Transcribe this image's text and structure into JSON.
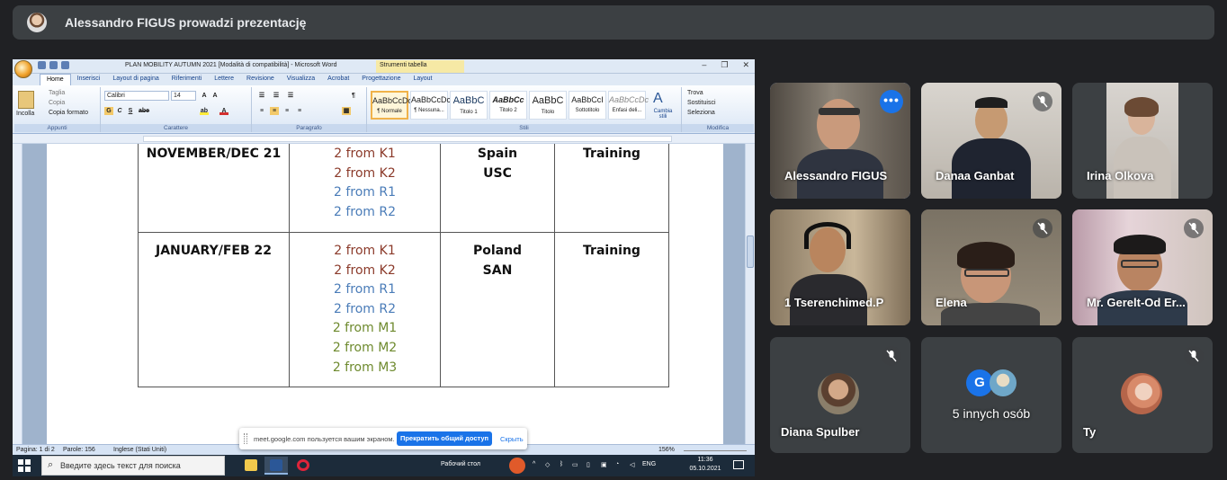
{
  "meet": {
    "header_title": "Alessandro FIGUS prowadzi prezentację"
  },
  "word": {
    "window_title": "PLAN MOBILITY AUTUMN 2021 [Modalità di compatibilità] - Microsoft Word",
    "tools_title": "Strumenti tabella",
    "tabs": [
      "Home",
      "Inserisci",
      "Layout di pagina",
      "Riferimenti",
      "Lettere",
      "Revisione",
      "Visualizza",
      "Acrobat",
      "Progettazione",
      "Layout"
    ],
    "clipboard": {
      "paste": "Incolla",
      "cut": "Taglia",
      "copy": "Copia",
      "format_painter": "Copia formato",
      "group": "Appunti"
    },
    "font": {
      "name": "Calibri",
      "size": "14",
      "group": "Carattere"
    },
    "paragraph_group": "Paragrafo",
    "styles": [
      {
        "preview": "AaBbCcDc",
        "name": "¶ Normale"
      },
      {
        "preview": "AaBbCcDc",
        "name": "¶ Nessuna..."
      },
      {
        "preview": "AaBbC",
        "name": "Titolo 1"
      },
      {
        "preview": "AaBbCc",
        "name": "Titolo 2"
      },
      {
        "preview": "AaBbC",
        "name": "Titolo"
      },
      {
        "preview": "AaBbCcI",
        "name": "Sottotitolo"
      },
      {
        "preview": "AaBbCcDc",
        "name": "Enfasi deli..."
      }
    ],
    "styles_group": "Stili",
    "change_styles": "Cambia stili",
    "editing": {
      "find": "Trova",
      "replace": "Sostituisci",
      "select": "Seleziona",
      "group": "Modifica"
    },
    "status": {
      "page": "Pagina: 1 di 2",
      "words": "Parole: 156",
      "language": "Inglese (Stati Uniti)",
      "zoom": "156%"
    }
  },
  "table": {
    "rows": [
      {
        "period": "NOVEMBER/DEC 21",
        "participants": [
          {
            "text": "2 from K1",
            "group": "K"
          },
          {
            "text": "2 from K2",
            "group": "K"
          },
          {
            "text": "2 from R1",
            "group": "R"
          },
          {
            "text": "2 from R2",
            "group": "R"
          }
        ],
        "destination": [
          "Spain",
          "USC"
        ],
        "activity": "Training"
      },
      {
        "period": "JANUARY/FEB 22",
        "participants": [
          {
            "text": "2 from K1",
            "group": "K"
          },
          {
            "text": "2 from K2",
            "group": "K"
          },
          {
            "text": "2 from R1",
            "group": "R"
          },
          {
            "text": "2 from R2",
            "group": "R"
          },
          {
            "text": "2 from M1",
            "group": "M"
          },
          {
            "text": "2 from M2",
            "group": "M"
          },
          {
            "text": "2 from M3",
            "group": "M"
          }
        ],
        "destination": [
          "Poland",
          "SAN"
        ],
        "activity": "Training"
      }
    ]
  },
  "share_notice": {
    "message": "meet.google.com пользуется вашим экраном.",
    "stop_button": "Прекратить общий доступ",
    "hide_link": "Скрыть"
  },
  "taskbar": {
    "search_placeholder": "Введите здесь текст для поиска",
    "desktop_label": "Рабочий стол",
    "lang": "ENG",
    "time": "11:36",
    "date": "05.10.2021"
  },
  "participants": [
    {
      "name": "Alessandro FIGUS",
      "muted": false,
      "video": true
    },
    {
      "name": "Danaa Ganbat",
      "muted": true,
      "video": true
    },
    {
      "name": "Irina Olkova",
      "muted": false,
      "video": true
    },
    {
      "name": "1 Tserenchimed.P",
      "muted": false,
      "video": true
    },
    {
      "name": "Elena",
      "muted": true,
      "video": true
    },
    {
      "name": "Mr. Gerelt-Od Er...",
      "muted": true,
      "video": true
    },
    {
      "name": "Diana Spulber",
      "muted": true,
      "video": false
    },
    {
      "name": "5 innych osób",
      "muted": false,
      "video": false,
      "avatar_letter": "G"
    },
    {
      "name": "Ty",
      "muted": true,
      "video": false
    }
  ],
  "colors": {
    "meet_bg": "#202124",
    "tile_bg": "#3c4043",
    "accent_blue": "#1a73e8",
    "selected_outline": "#8ab4f8",
    "group_K": "#8b3a2a",
    "group_R": "#4a7cb8",
    "group_M": "#6e8a2e"
  }
}
